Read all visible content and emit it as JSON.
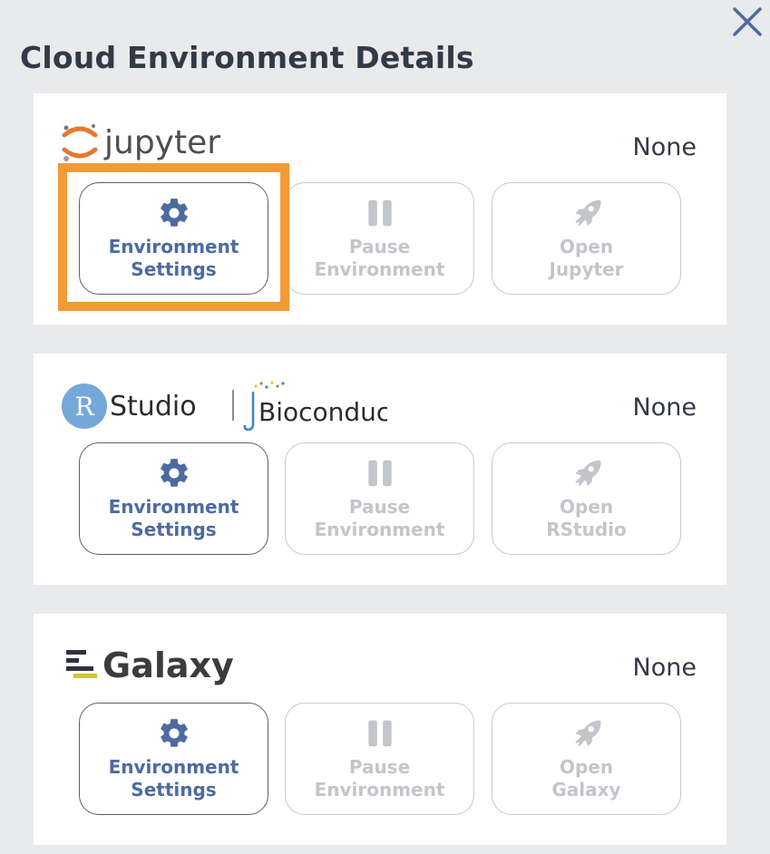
{
  "dialog": {
    "title": "Cloud Environment Details",
    "close_icon": "close-icon"
  },
  "colors": {
    "background": "#e9eaec",
    "accent": "#4d6aa1",
    "disabled": "#c2c5ca",
    "highlight": "#f29a36"
  },
  "environments": [
    {
      "name": "Jupyter",
      "logo_text": "jupyter",
      "status": "None",
      "buttons": {
        "settings": "Environment\nSettings",
        "pause": "Pause\nEnvironment",
        "open": "Open\nJupyter"
      }
    },
    {
      "name": "RStudio",
      "logo_text_studio": "Studio",
      "logo_text_r": "R",
      "logo_text_bioc": "Bioconductor",
      "status": "None",
      "buttons": {
        "settings": "Environment\nSettings",
        "pause": "Pause\nEnvironment",
        "open": "Open\nRStudio"
      }
    },
    {
      "name": "Galaxy",
      "logo_text": "Galaxy",
      "status": "None",
      "buttons": {
        "settings": "Environment\nSettings",
        "pause": "Pause\nEnvironment",
        "open": "Open\nGalaxy"
      }
    }
  ],
  "icons": {
    "settings": "gear-icon",
    "pause": "pause-icon",
    "open": "rocket-icon"
  }
}
